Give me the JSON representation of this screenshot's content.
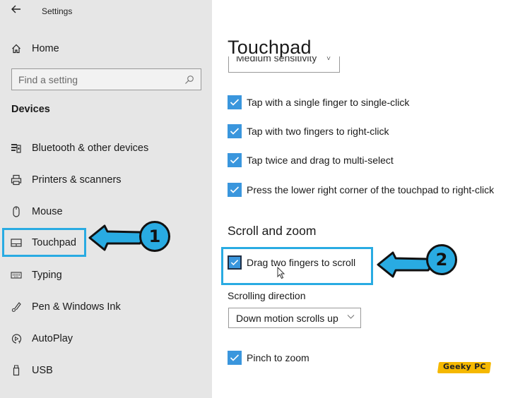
{
  "window": {
    "title": "Settings",
    "back_icon": "back-arrow-icon"
  },
  "sidebar": {
    "home_label": "Home",
    "home_icon": "home-icon",
    "search": {
      "placeholder": "Find a setting",
      "value": "",
      "icon": "search-icon"
    },
    "section_title": "Devices",
    "items": [
      {
        "label": "Bluetooth & other devices",
        "icon": "bluetooth-devices-icon",
        "active": false
      },
      {
        "label": "Printers & scanners",
        "icon": "printer-icon",
        "active": false
      },
      {
        "label": "Mouse",
        "icon": "mouse-icon",
        "active": false
      },
      {
        "label": "Touchpad",
        "icon": "touchpad-icon",
        "active": true
      },
      {
        "label": "Typing",
        "icon": "keyboard-icon",
        "active": false
      },
      {
        "label": "Pen & Windows Ink",
        "icon": "pen-icon",
        "active": false
      },
      {
        "label": "AutoPlay",
        "icon": "autoplay-icon",
        "active": false
      },
      {
        "label": "USB",
        "icon": "usb-icon",
        "active": false
      }
    ]
  },
  "main": {
    "page_title": "Touchpad",
    "sensitivity_dropdown": {
      "value": "Medium sensitivity"
    },
    "tap_options": [
      {
        "label": "Tap with a single finger to single-click",
        "checked": true
      },
      {
        "label": "Tap with two fingers to right-click",
        "checked": true
      },
      {
        "label": "Tap twice and drag to multi-select",
        "checked": true
      },
      {
        "label": "Press the lower right corner of the touchpad to right-click",
        "checked": true
      }
    ],
    "scroll_section": {
      "heading": "Scroll and zoom",
      "drag_scroll": {
        "label": "Drag two fingers to scroll",
        "checked": true
      },
      "direction_label": "Scrolling direction",
      "direction_value": "Down motion scrolls up",
      "pinch_zoom": {
        "label": "Pinch to zoom",
        "checked": true
      }
    }
  },
  "annotations": {
    "step1": "1",
    "step2": "2",
    "accent_color": "#29abe2"
  },
  "watermark": {
    "text": "Geeky PC",
    "color": "#f5b800"
  },
  "colors": {
    "sidebar_bg": "#e6e6e6",
    "checkbox_blue": "#3a96dd"
  }
}
